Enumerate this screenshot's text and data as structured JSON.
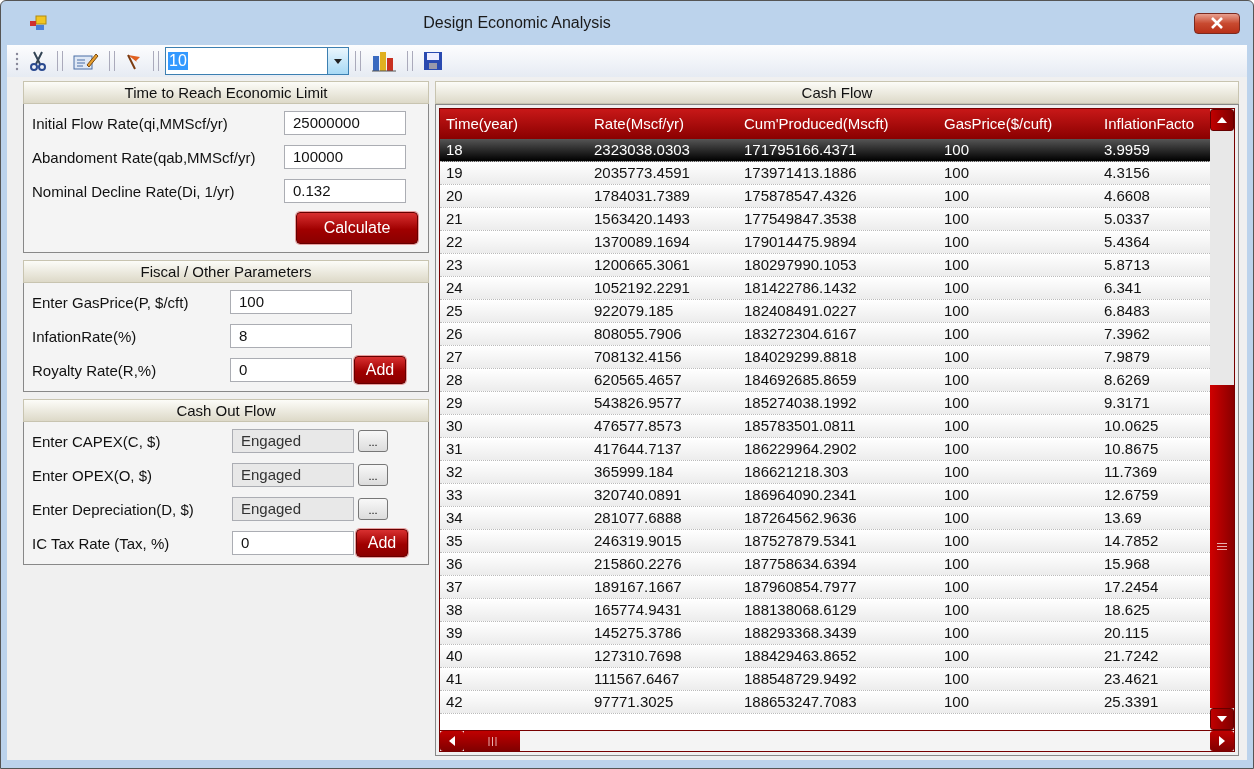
{
  "window": {
    "title": "Design Economic Analysis"
  },
  "toolbar": {
    "combo_value": "10"
  },
  "panels": [
    {
      "title": "Time to Reach Economic Limit",
      "kind": "limit",
      "fields": [
        {
          "label": "Initial Flow Rate(qi,MMScf/yr)",
          "value": "25000000",
          "kind": "input"
        },
        {
          "label": "Abandoment Rate(qab,MMScf/yr)",
          "value": "100000",
          "kind": "input"
        },
        {
          "label": "Nominal Decline Rate(Di, 1/yr)",
          "value": "0.132",
          "kind": "input"
        }
      ],
      "button": "Calculate"
    },
    {
      "title": "Fiscal / Other Parameters",
      "kind": "fiscal",
      "fields": [
        {
          "label": "Enter GasPrice(P, $/cft)",
          "value": "100",
          "kind": "input"
        },
        {
          "label": "InfationRate(%)",
          "value": "8",
          "kind": "input"
        },
        {
          "label": "Royalty Rate(R,%)",
          "value": "0",
          "kind": "add",
          "button": "Add"
        }
      ]
    },
    {
      "title": "Cash Out Flow",
      "kind": "cashout",
      "fields": [
        {
          "label": "Enter CAPEX(C, $)",
          "value": "Engaged",
          "kind": "browse",
          "button": "...",
          "disabled": true
        },
        {
          "label": "Enter OPEX(O, $)",
          "value": "Engaged",
          "kind": "browse",
          "button": "...",
          "disabled": true
        },
        {
          "label": "Enter Depreciation(D, $)",
          "value": "Engaged",
          "kind": "browse",
          "button": "...",
          "disabled": true
        },
        {
          "label": "IC Tax Rate (Tax, %)",
          "value": "0",
          "kind": "add",
          "button": "Add",
          "disabled": false
        }
      ]
    }
  ],
  "table": {
    "title": "Cash Flow",
    "columns": [
      "Time(year)",
      "Rate(Mscf/yr)",
      "Cum'Produced(Mscft)",
      "GasPrice($/cuft)",
      "InflationFacto"
    ],
    "rows": [
      {
        "cells": [
          "18",
          "2323038.0303",
          "171795166.4371",
          "100",
          "3.9959"
        ],
        "selected": true
      },
      {
        "cells": [
          "19",
          "2035773.4591",
          "173971413.1886",
          "100",
          "4.3156"
        ],
        "selected": false
      },
      {
        "cells": [
          "20",
          "1784031.7389",
          "175878547.4326",
          "100",
          "4.6608"
        ],
        "selected": false
      },
      {
        "cells": [
          "21",
          "1563420.1493",
          "177549847.3538",
          "100",
          "5.0337"
        ],
        "selected": false
      },
      {
        "cells": [
          "22",
          "1370089.1694",
          "179014475.9894",
          "100",
          "5.4364"
        ],
        "selected": false
      },
      {
        "cells": [
          "23",
          "1200665.3061",
          "180297990.1053",
          "100",
          "5.8713"
        ],
        "selected": false
      },
      {
        "cells": [
          "24",
          "1052192.2291",
          "181422786.1432",
          "100",
          "6.341"
        ],
        "selected": false
      },
      {
        "cells": [
          "25",
          "922079.185",
          "182408491.0227",
          "100",
          "6.8483"
        ],
        "selected": false
      },
      {
        "cells": [
          "26",
          "808055.7906",
          "183272304.6167",
          "100",
          "7.3962"
        ],
        "selected": false
      },
      {
        "cells": [
          "27",
          "708132.4156",
          "184029299.8818",
          "100",
          "7.9879"
        ],
        "selected": false
      },
      {
        "cells": [
          "28",
          "620565.4657",
          "184692685.8659",
          "100",
          "8.6269"
        ],
        "selected": false
      },
      {
        "cells": [
          "29",
          "543826.9577",
          "185274038.1992",
          "100",
          "9.3171"
        ],
        "selected": false
      },
      {
        "cells": [
          "30",
          "476577.8573",
          "185783501.0811",
          "100",
          "10.0625"
        ],
        "selected": false
      },
      {
        "cells": [
          "31",
          "417644.7137",
          "186229964.2902",
          "100",
          "10.8675"
        ],
        "selected": false
      },
      {
        "cells": [
          "32",
          "365999.184",
          "186621218.303",
          "100",
          "11.7369"
        ],
        "selected": false
      },
      {
        "cells": [
          "33",
          "320740.0891",
          "186964090.2341",
          "100",
          "12.6759"
        ],
        "selected": false
      },
      {
        "cells": [
          "34",
          "281077.6888",
          "187264562.9636",
          "100",
          "13.69"
        ],
        "selected": false
      },
      {
        "cells": [
          "35",
          "246319.9015",
          "187527879.5341",
          "100",
          "14.7852"
        ],
        "selected": false
      },
      {
        "cells": [
          "36",
          "215860.2276",
          "187758634.6394",
          "100",
          "15.968"
        ],
        "selected": false
      },
      {
        "cells": [
          "37",
          "189167.1667",
          "187960854.7977",
          "100",
          "17.2454"
        ],
        "selected": false
      },
      {
        "cells": [
          "38",
          "165774.9431",
          "188138068.6129",
          "100",
          "18.625"
        ],
        "selected": false
      },
      {
        "cells": [
          "39",
          "145275.3786",
          "188293368.3439",
          "100",
          "20.115"
        ],
        "selected": false
      },
      {
        "cells": [
          "40",
          "127310.7698",
          "188429463.8652",
          "100",
          "21.7242"
        ],
        "selected": false
      },
      {
        "cells": [
          "41",
          "111567.6467",
          "188548729.9492",
          "100",
          "23.4621"
        ],
        "selected": false
      },
      {
        "cells": [
          "42",
          "97771.3025",
          "188653247.7083",
          "100",
          "25.3391"
        ],
        "selected": false
      }
    ]
  }
}
